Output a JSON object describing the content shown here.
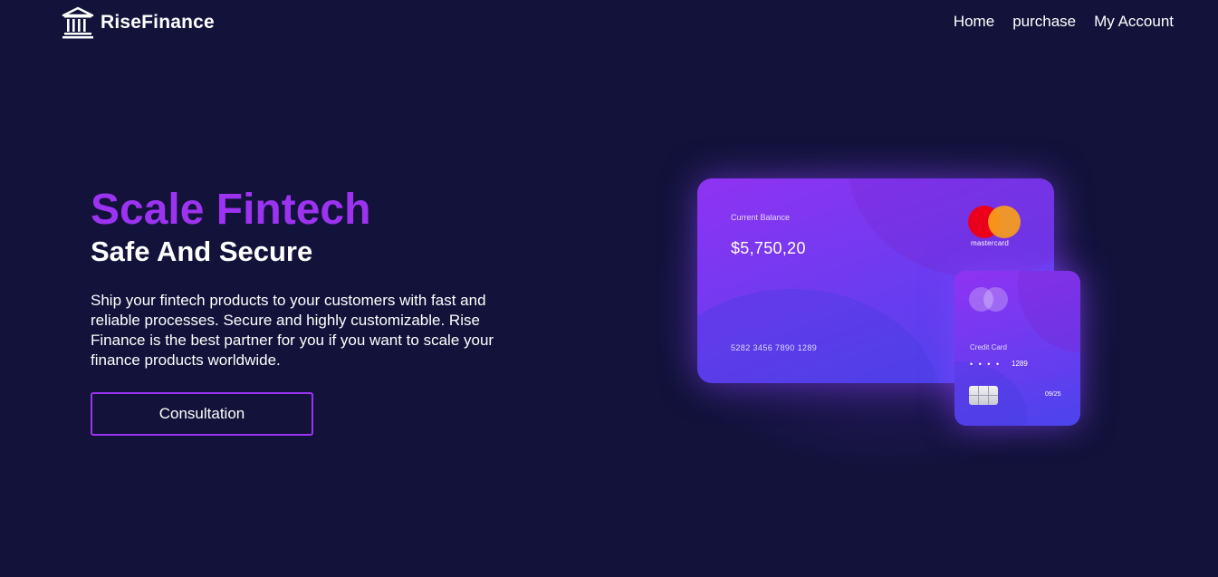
{
  "brand": {
    "name": "RiseFinance",
    "icon": "bank-icon"
  },
  "nav": {
    "items": [
      {
        "label": "Home"
      },
      {
        "label": "purchase"
      },
      {
        "label": "My Account"
      }
    ]
  },
  "hero": {
    "title": "Scale Fintech",
    "subtitle": "Safe And Secure",
    "description": "Ship your fintech products to your customers with fast and reliable processes. Secure and highly customizable. Rise Finance is the best partner for you if you want to scale your finance products worldwide.",
    "cta_label": "Consultation"
  },
  "cards": {
    "main": {
      "balance_label": "Current Balance",
      "balance_amount": "$5,750,20",
      "brand_text": "mastercard",
      "number": "5282 3456 7890 1289"
    },
    "small": {
      "label": "Credit Card",
      "masked": "• • • •",
      "last_digits": "1289",
      "expiry": "09/25"
    }
  },
  "colors": {
    "background": "#12123a",
    "accent": "#9b33f0",
    "card_gradient_start": "#8f33f2",
    "card_gradient_end": "#4a44ec"
  }
}
